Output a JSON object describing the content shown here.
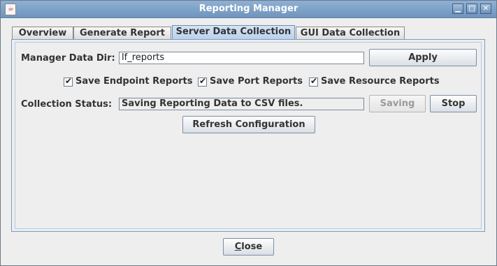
{
  "window": {
    "title": "Reporting Manager"
  },
  "tabs": [
    {
      "label": "Overview"
    },
    {
      "label": "Generate Report"
    },
    {
      "label": "Server Data Collection",
      "active": true
    },
    {
      "label": "GUI Data Collection"
    }
  ],
  "manager_dir": {
    "label": "Manager Data Dir:",
    "value": "lf_reports",
    "apply_label": "Apply"
  },
  "checkboxes": [
    {
      "label": "Save Endpoint Reports",
      "checked": true
    },
    {
      "label": "Save Port Reports",
      "checked": true
    },
    {
      "label": "Save Resource Reports",
      "checked": true
    }
  ],
  "status": {
    "label": "Collection Status:",
    "value": "Saving Reporting Data to CSV files.",
    "saving_label": "Saving",
    "stop_label": "Stop"
  },
  "refresh_label": "Refresh Configuration",
  "close": {
    "first": "C",
    "rest": "lose"
  },
  "icons": {
    "app": "java-app-icon",
    "min": "minimize-icon",
    "max": "maximize-icon",
    "close": "close-icon"
  },
  "colors": {
    "titlebar": "#7fa2c9",
    "active_tab": "#c6daf1"
  }
}
